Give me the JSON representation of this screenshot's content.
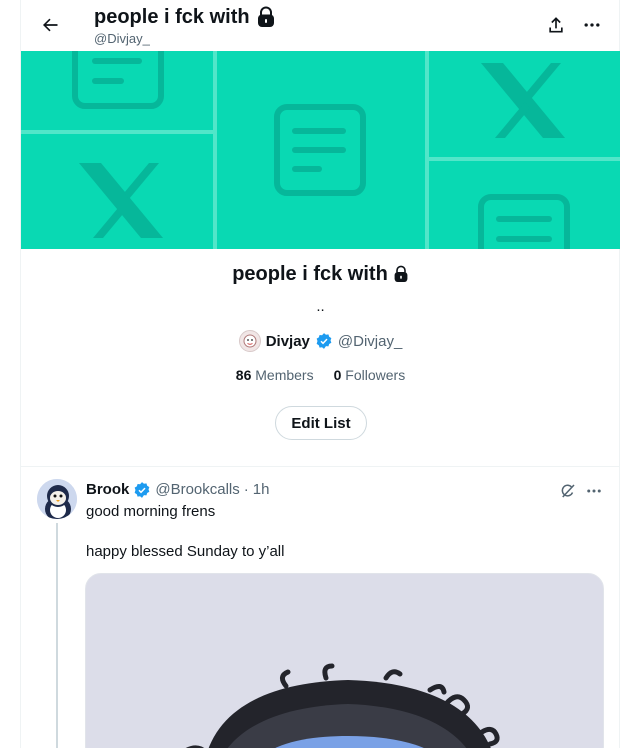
{
  "header": {
    "title": "people i fck with",
    "handle": "@Divjay_",
    "back_icon": "arrow-left-icon",
    "share_icon": "share-icon",
    "more_icon": "more-icon"
  },
  "banner": {
    "color": "#09d9b3"
  },
  "list": {
    "name": "people i fck with",
    "lock_icon": "lock-icon",
    "description": "..",
    "owner": {
      "name": "Divjay",
      "handle": "@Divjay_",
      "verified": true
    },
    "members": {
      "count": "86",
      "label": "Members"
    },
    "followers": {
      "count": "0",
      "label": "Followers"
    },
    "edit_label": "Edit List"
  },
  "tweet": {
    "author": "Brook",
    "verified": true,
    "handle": "@Brookcalls",
    "separator": "·",
    "time": "1h",
    "text_line1": "good morning frens",
    "text_line2": "happy blessed Sunday to y’all"
  },
  "colors": {
    "accent": "#1d9bf0",
    "text": "#0f1419",
    "muted": "#536471"
  }
}
